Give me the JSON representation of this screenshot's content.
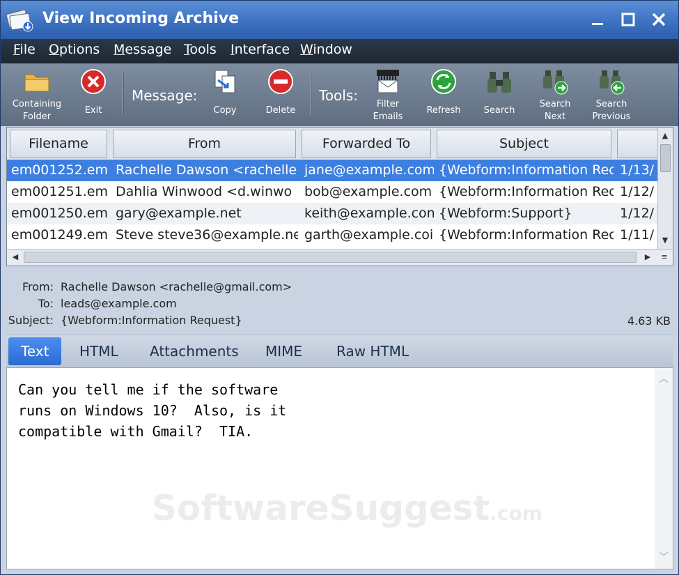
{
  "window": {
    "title": "View Incoming Archive"
  },
  "menu": [
    {
      "pre": "",
      "u": "F",
      "post": "ile"
    },
    {
      "pre": "",
      "u": "O",
      "post": "ptions"
    },
    {
      "pre": "",
      "u": "M",
      "post": "essage"
    },
    {
      "pre": "",
      "u": "T",
      "post": "ools"
    },
    {
      "pre": "",
      "u": "I",
      "post": "nterface"
    },
    {
      "pre": "",
      "u": "W",
      "post": "indow"
    }
  ],
  "toolbar": {
    "containing_folder": "Containing\nFolder",
    "exit": "Exit",
    "message_group": "Message:",
    "copy": "Copy",
    "delete": "Delete",
    "tools_group": "Tools:",
    "filter_emails": "Filter\nEmails",
    "refresh": "Refresh",
    "search": "Search",
    "search_next": "Search\nNext",
    "search_previous": "Search\nPrevious"
  },
  "grid": {
    "columns": [
      "Filename",
      "From",
      "Forwarded To",
      "Subject"
    ],
    "rows": [
      {
        "filename": "em001252.em",
        "from": "Rachelle Dawson <rachelle(",
        "to": "jane@example.com",
        "subject": "{Webform:Information Rec",
        "date": "1/13/"
      },
      {
        "filename": "em001251.em",
        "from": "Dahlia Winwood <d.winwo",
        "to": "bob@example.com",
        "subject": "{Webform:Information Rec",
        "date": "1/12/"
      },
      {
        "filename": "em001250.em",
        "from": "gary@example.net",
        "to": "keith@example.con",
        "subject": "{Webform:Support}",
        "date": "1/12/"
      },
      {
        "filename": "em001249.em",
        "from": "Steve steve36@example.ne",
        "to": "garth@example.coi",
        "subject": "{Webform:Information Rec",
        "date": "1/11/"
      }
    ]
  },
  "details": {
    "from_label": "From:",
    "from_value": "Rachelle Dawson <rachelle@gmail.com>",
    "to_label": "To:",
    "to_value": "leads@example.com",
    "subject_label": "Subject:",
    "subject_value": "{Webform:Information Request}",
    "size": "4.63 KB"
  },
  "tabs": [
    "Text",
    "HTML",
    "Attachments",
    "MIME",
    "Raw HTML"
  ],
  "body": {
    "text": "Can you tell me if the software\nruns on Windows 10?  Also, is it\ncompatible with Gmail?  TIA."
  },
  "watermark": {
    "main": "SoftwareSuggest",
    "suffix": ".com"
  }
}
